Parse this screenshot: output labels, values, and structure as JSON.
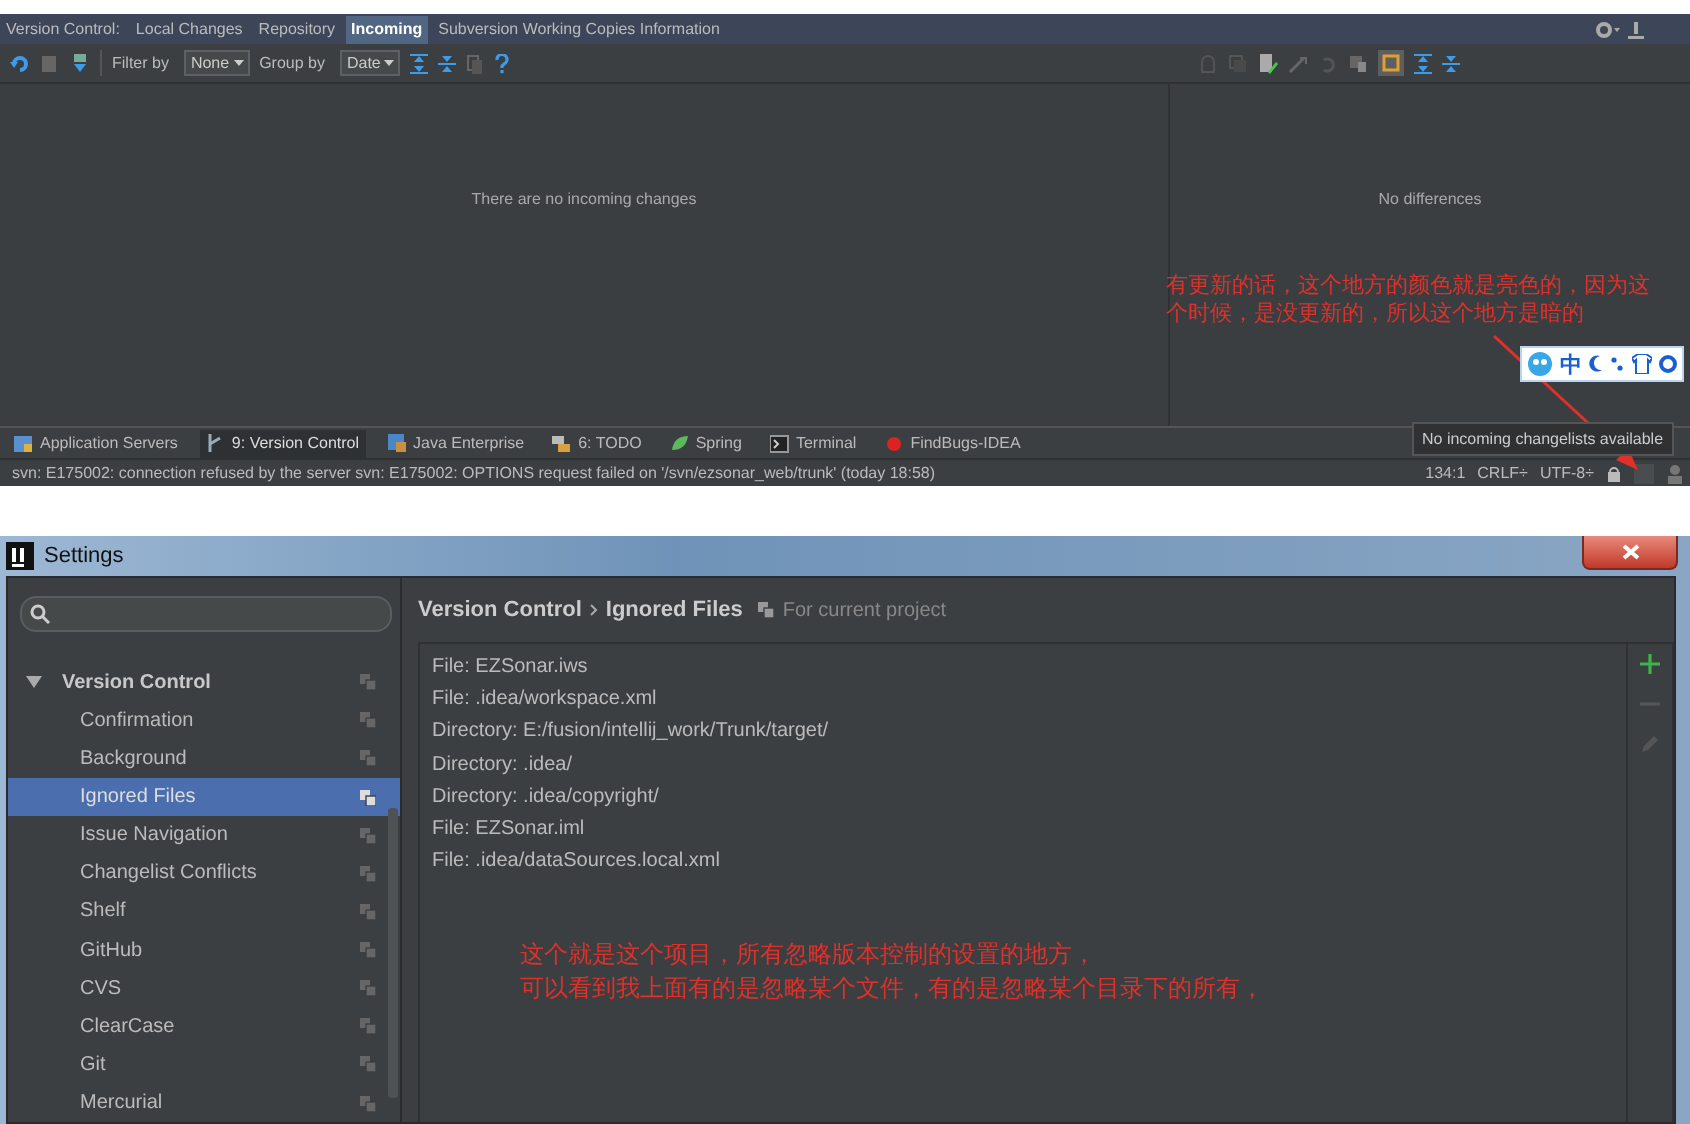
{
  "ide": {
    "label": "Version Control:",
    "tabs": [
      {
        "label": "Local Changes",
        "selected": false
      },
      {
        "label": "Repository",
        "selected": false
      },
      {
        "label": "Incoming",
        "selected": true
      },
      {
        "label": "Subversion Working Copies Information",
        "selected": false
      }
    ],
    "toolbar": {
      "filter_label": "Filter by",
      "filter_value": "None",
      "group_label": "Group by",
      "group_value": "Date"
    },
    "left_message": "There are no incoming changes",
    "right_message": "No differences",
    "tool_tabs": [
      {
        "label": "Application Servers",
        "selected": false
      },
      {
        "label": "9: Version Control",
        "selected": true
      },
      {
        "label": "Java Enterprise",
        "selected": false
      },
      {
        "label": "6: TODO",
        "selected": false
      },
      {
        "label": "Spring",
        "selected": false
      },
      {
        "label": "Terminal",
        "selected": false
      },
      {
        "label": "FindBugs-IDEA",
        "selected": false
      }
    ],
    "status_message": "svn: E175002: connection refused by the server svn: E175002: OPTIONS request failed on '/svn/ezsonar_web/trunk' (today 18:58)",
    "status_items": [
      "134:1",
      "CRLF÷",
      "UTF-8÷"
    ],
    "tooltip": "No incoming changelists available"
  },
  "ime_bar": {
    "label": "中"
  },
  "top_note": [
    "有更新的话，这个地方的颜色就是亮色的，因为这",
    "个时候，是没更新的，所以这个地方是暗的"
  ],
  "settings": {
    "title": "Settings",
    "tree": [
      {
        "label": "Version Control",
        "expanded": true,
        "children": [
          {
            "label": "Confirmation",
            "selected": false
          },
          {
            "label": "Background",
            "selected": false
          },
          {
            "label": "Ignored Files",
            "selected": true
          },
          {
            "label": "Issue Navigation",
            "selected": false
          },
          {
            "label": "Changelist Conflicts",
            "selected": false
          },
          {
            "label": "Shelf",
            "selected": false
          },
          {
            "label": "GitHub",
            "selected": false
          },
          {
            "label": "CVS",
            "selected": false
          },
          {
            "label": "ClearCase",
            "selected": false
          },
          {
            "label": "Git",
            "selected": false
          },
          {
            "label": "Mercurial",
            "selected": false
          }
        ]
      }
    ],
    "breadcrumb": [
      "Version Control",
      "Ignored Files"
    ],
    "scope": "For current project",
    "ignored": [
      "File: EZSonar.iws",
      "File: .idea/workspace.xml",
      "Directory: E:/fusion/intellij_work/Trunk/target/",
      "Directory: .idea/",
      "Directory: .idea/copyright/",
      "File: EZSonar.iml",
      "File: .idea/dataSources.local.xml"
    ],
    "note": [
      "这个就是这个项目，所有忽略版本控制的设置的地方，",
      "可以看到我上面有的是忽略某个文件，有的是忽略某个目录下的所有，"
    ]
  }
}
